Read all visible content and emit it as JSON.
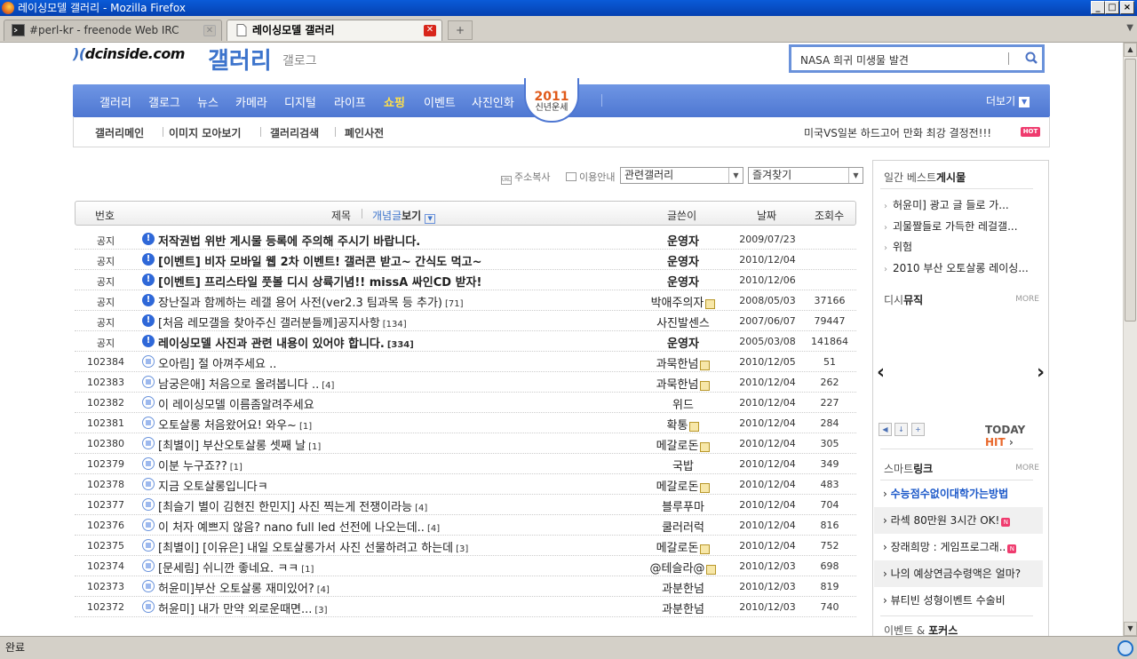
{
  "window": {
    "title": "레이싱모델 갤러리 - Mozilla Firefox"
  },
  "tabs": [
    {
      "label": "#perl-kr - freenode Web IRC"
    },
    {
      "label": "레이싱모델 갤러리"
    }
  ],
  "status": {
    "text": "완료"
  },
  "header": {
    "logo": "dcinside.com",
    "gallery_title": "갤러리",
    "galog": "갤로그",
    "search_value": "NASA 희귀 미생물 발견"
  },
  "nav": {
    "items": [
      "갤러리",
      "갤로그",
      "뉴스",
      "카메라",
      "디지털",
      "라이프",
      "쇼핑",
      "이벤트",
      "사진인화",
      "뮤직"
    ],
    "badge_year": "2011",
    "badge_text": "신년운세",
    "more": "더보기"
  },
  "subnav": {
    "items": [
      "갤러리메인",
      "이미지 모아보기",
      "갤러리검색",
      "폐인사전"
    ],
    "promo": "미국VS일본 하드고어 만화 최강 결정전!!!",
    "hot": "HOT"
  },
  "tools": {
    "copy_address": "주소복사",
    "usage": "이용안내",
    "related": "관련갤러리",
    "favorites": "즐겨찾기"
  },
  "table": {
    "headers": {
      "no": "번호",
      "title": "제목",
      "concept_a": "개념글",
      "concept_b": "보기",
      "writer": "글쓴이",
      "date": "날짜",
      "views": "조회수"
    },
    "rows": [
      {
        "no": "공지",
        "type": "notice",
        "title": "저작권법 위반 게시물 등록에 주의해 주시기 바랍니다.",
        "bold": true,
        "comments": "",
        "writer": "운영자",
        "wbold": true,
        "lock": false,
        "date": "2009/07/23",
        "views": ""
      },
      {
        "no": "공지",
        "type": "notice",
        "title": "[이벤트] 비자 모바일 웹 2차 이벤트! 갤러콘 받고~ 간식도 먹고~",
        "bold": true,
        "comments": "",
        "writer": "운영자",
        "wbold": true,
        "lock": false,
        "date": "2010/12/04",
        "views": ""
      },
      {
        "no": "공지",
        "type": "notice",
        "title": "[이벤트] 프리스타일 풋볼 디시 상륙기념!! missA 싸인CD 받자!",
        "bold": true,
        "comments": "",
        "writer": "운영자",
        "wbold": true,
        "lock": false,
        "date": "2010/12/06",
        "views": ""
      },
      {
        "no": "공지",
        "type": "notice",
        "title": "장난질과 함께하는 레갤 용어 사전(ver2.3 팀과목 등 추가)",
        "bold": false,
        "comments": "[71]",
        "writer": "박애주의자",
        "wbold": false,
        "lock": true,
        "date": "2008/05/03",
        "views": "37166"
      },
      {
        "no": "공지",
        "type": "notice",
        "title": "[처음 레모갤을 찾아주신 갤러분들께]공지사항",
        "bold": false,
        "comments": "[134]",
        "writer": "사진발센스",
        "wbold": false,
        "lock": false,
        "date": "2007/06/07",
        "views": "79447"
      },
      {
        "no": "공지",
        "type": "notice",
        "title": "레이싱모델 사진과 관련 내용이 있어야 합니다.",
        "bold": true,
        "comments": "[334]",
        "writer": "운영자",
        "wbold": true,
        "lock": false,
        "date": "2005/03/08",
        "views": "141864"
      },
      {
        "no": "102384",
        "type": "post",
        "title": "오아림] 절 아껴주세요 ..",
        "bold": false,
        "comments": "",
        "writer": "과묵한넘",
        "wbold": false,
        "lock": true,
        "date": "2010/12/05",
        "views": "51"
      },
      {
        "no": "102383",
        "type": "post",
        "title": "남궁은애] 처음으로 올려봅니다 ..",
        "bold": false,
        "comments": "[4]",
        "writer": "과묵한넘",
        "wbold": false,
        "lock": true,
        "date": "2010/12/04",
        "views": "262"
      },
      {
        "no": "102382",
        "type": "post",
        "title": "이 레이싱모델 이름좀알려주세요",
        "bold": false,
        "comments": "",
        "writer": "위드",
        "wbold": false,
        "lock": false,
        "date": "2010/12/04",
        "views": "227"
      },
      {
        "no": "102381",
        "type": "post",
        "title": "오토살롱 처음왔어요! 와우~",
        "bold": false,
        "comments": "[1]",
        "writer": "확통",
        "wbold": false,
        "lock": true,
        "date": "2010/12/04",
        "views": "284"
      },
      {
        "no": "102380",
        "type": "post",
        "title": "[최별이] 부산오토살롱 셋째 날",
        "bold": false,
        "comments": "[1]",
        "writer": "메갈로돈",
        "wbold": false,
        "lock": true,
        "date": "2010/12/04",
        "views": "305"
      },
      {
        "no": "102379",
        "type": "post",
        "title": "이분 누구죠??",
        "bold": false,
        "comments": "[1]",
        "writer": "국밥",
        "wbold": false,
        "lock": false,
        "date": "2010/12/04",
        "views": "349"
      },
      {
        "no": "102378",
        "type": "post",
        "title": "지금 오토살롱입니다ㅋ",
        "bold": false,
        "comments": "",
        "writer": "메갈로돈",
        "wbold": false,
        "lock": true,
        "date": "2010/12/04",
        "views": "483"
      },
      {
        "no": "102377",
        "type": "post",
        "title": "[최슬기 별이 김현진 한민지] 사진 찍는게 전쟁이라능",
        "bold": false,
        "comments": "[4]",
        "writer": "블루푸마",
        "wbold": false,
        "lock": false,
        "date": "2010/12/04",
        "views": "704"
      },
      {
        "no": "102376",
        "type": "post",
        "title": "이 처자 예쁘지 않음? nano full led 선전에 나오는데..",
        "bold": false,
        "comments": "[4]",
        "writer": "쿨러러럭",
        "wbold": false,
        "lock": false,
        "date": "2010/12/04",
        "views": "816"
      },
      {
        "no": "102375",
        "type": "post",
        "title": "[최별이] [이유은] 내일 오토살롱가서 사진 선물하려고 하는데",
        "bold": false,
        "comments": "[3]",
        "writer": "메갈로돈",
        "wbold": false,
        "lock": true,
        "date": "2010/12/04",
        "views": "752"
      },
      {
        "no": "102374",
        "type": "post",
        "title": "[문세림] 쉬니깐 좋네요. ㅋㅋ",
        "bold": false,
        "comments": "[1]",
        "writer": "@테슬라@",
        "wbold": false,
        "lock": true,
        "date": "2010/12/03",
        "views": "698"
      },
      {
        "no": "102373",
        "type": "post",
        "title": "허윤미]부산 오토살롱 재미있어?",
        "bold": false,
        "comments": "[4]",
        "writer": "과분한넘",
        "wbold": false,
        "lock": false,
        "date": "2010/12/03",
        "views": "819"
      },
      {
        "no": "102372",
        "type": "post",
        "title": "허윤미] 내가 만약 외로운때면...",
        "bold": false,
        "comments": "[3]",
        "writer": "과분한넘",
        "wbold": false,
        "lock": false,
        "date": "2010/12/03",
        "views": "740"
      }
    ]
  },
  "sidebar": {
    "best_a": "일간 베스트",
    "best_b": "게시물",
    "best_items": [
      "허윤미] 광고 글 들로 가...",
      "괴물짤들로 가득한 레걸갤...",
      "위험",
      "2010 부산 오토살롱 레이싱..."
    ],
    "music_a": "디시",
    "music_b": "뮤직",
    "more": "MORE",
    "prev": "‹",
    "next": "›",
    "today": "TODAY",
    "hit": "HIT",
    "smart_a": "스마트",
    "smart_b": "링크",
    "smart_items": [
      "수능점수없이대학가는방법",
      "라섹 80만원 3시간 OK!",
      "장래희망 : 게임프로그래..",
      "나의 예상연금수령액은 얼마?",
      "뷰티빈 성형이벤트 수술비"
    ],
    "event_a": "이벤트 &",
    "event_b": "포커스"
  }
}
